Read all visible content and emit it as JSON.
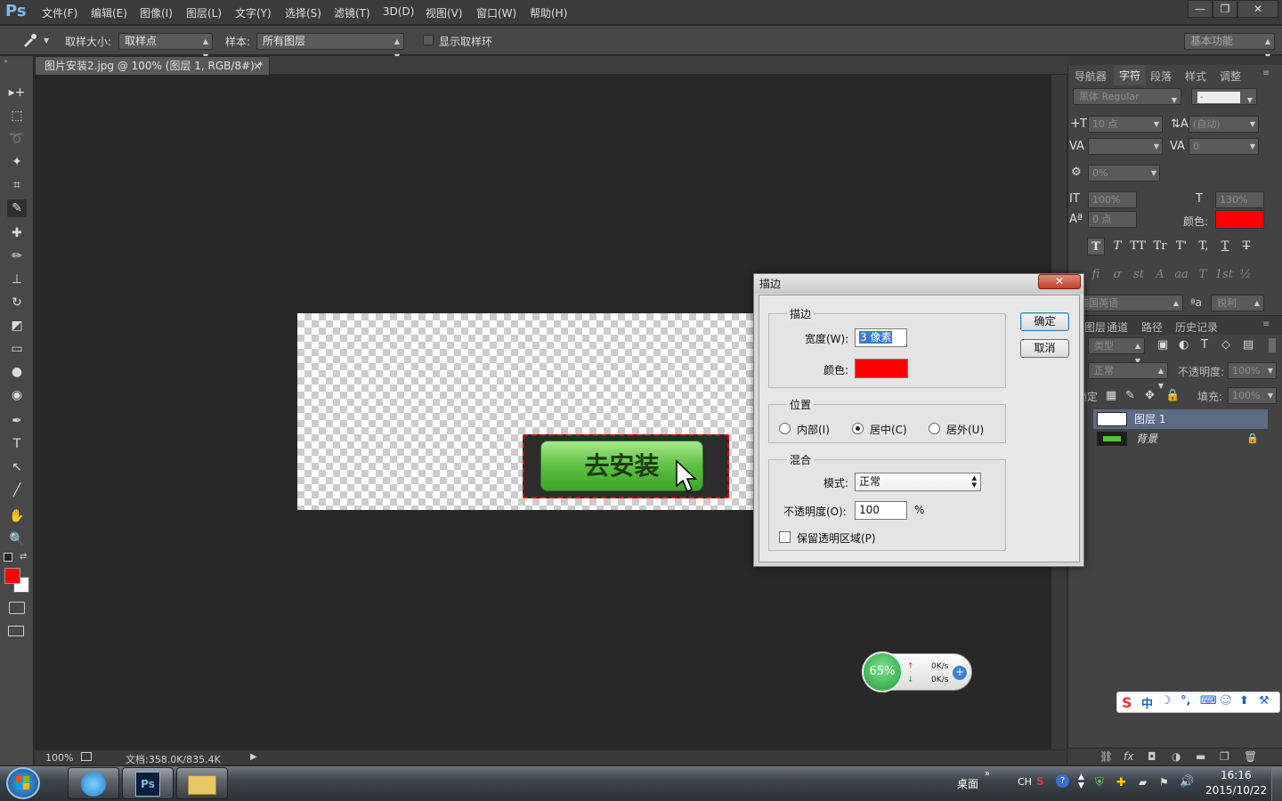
{
  "app": {
    "logo": "Ps",
    "menus": [
      "文件(F)",
      "编辑(E)",
      "图像(I)",
      "图层(L)",
      "文字(Y)",
      "选择(S)",
      "滤镜(T)",
      "3D(D)",
      "视图(V)",
      "窗口(W)",
      "帮助(H)"
    ],
    "window_buttons": [
      "—",
      "❐",
      "✕"
    ]
  },
  "options": {
    "sample_size_label": "取样大小:",
    "sample_size_value": "取样点",
    "sample_label": "样本:",
    "sample_value": "所有图层",
    "show_ring_label": "显示取样环",
    "workspace": "基本功能"
  },
  "document": {
    "tab_title": "图片安装2.jpg @ 100% (图层 1, RGB/8#) *",
    "tab_close": "×",
    "button_text": "去安装",
    "zoom": "100%",
    "doc_info": "文档:358.0K/835.4K"
  },
  "tools": [
    "move-icon",
    "marquee-icon",
    "lasso-icon",
    "magic-wand-icon",
    "crop-icon",
    "eyedropper-icon",
    "spot-heal-icon",
    "brush-icon",
    "stamp-icon",
    "history-brush-icon",
    "eraser-icon",
    "gradient-icon",
    "blur-icon",
    "dodge-icon",
    "pen-icon",
    "type-icon",
    "path-select-icon",
    "line-icon",
    "hand-icon",
    "zoom-icon"
  ],
  "colors": {
    "foreground": "#ff0000",
    "background": "#ffffff",
    "stroke_color": "#ff0000",
    "char_color": "#ff0000"
  },
  "character_panel": {
    "tabs": [
      "导航器",
      "字符",
      "段落",
      "样式",
      "调整"
    ],
    "active_tab": "字符",
    "font_family": "黑体 Regular",
    "font_style": "-",
    "font_size": "10 点",
    "leading": "(自动)",
    "kerning": "",
    "tracking": "0",
    "scale_pct": "0%",
    "vscale": "100%",
    "hscale": "130%",
    "baseline": "0 点",
    "color_label": "颜色:",
    "style_buttons": [
      "T",
      "T",
      "TT",
      "Tr",
      "T'",
      "T,",
      "T",
      "T"
    ],
    "opentype_buttons": [
      "fi",
      "σ",
      "st",
      "A",
      "aa",
      "T",
      "1st",
      "½"
    ],
    "language": "美国英语",
    "aa_label": "ªa",
    "antialias": "锐利"
  },
  "layers_panel": {
    "tabs": [
      "图层",
      "通道",
      "路径",
      "历史记录"
    ],
    "filter": "类型",
    "blend_mode": "正常",
    "opacity_label": "不透明度:",
    "opacity": "100%",
    "lock_label": "锁定:",
    "fill_label": "填充:",
    "fill": "100%",
    "layers": [
      {
        "name": "图层 1",
        "selected": true
      },
      {
        "name": "背景",
        "selected": false
      }
    ],
    "footer_icons": [
      "link-icon",
      "fx-icon",
      "mask-icon",
      "adjustment-icon",
      "folder-icon",
      "new-layer-icon",
      "trash-icon"
    ]
  },
  "dialog": {
    "title": "描边",
    "close": "✕",
    "stroke_group": "描边",
    "width_label": "宽度(W):",
    "width_value": "3 像素",
    "color_label": "颜色:",
    "position_group": "位置",
    "positions": [
      "内部(I)",
      "居中(C)",
      "居外(U)"
    ],
    "selected_position": "居中(C)",
    "blend_group": "混合",
    "mode_label": "模式:",
    "mode_value": "正常",
    "opacity_label": "不透明度(O):",
    "opacity_value": "100",
    "percent": "%",
    "preserve_label": "保留透明区域(P)",
    "ok": "确定",
    "cancel": "取消"
  },
  "widget": {
    "percent": "65%",
    "up": "0K/s",
    "down": "0K/s"
  },
  "ime": {
    "items": [
      "S",
      "中",
      "☽",
      "°,",
      "⌨",
      "☺",
      "⬆",
      "⚒"
    ]
  },
  "taskbar": {
    "desktop": "桌面",
    "lang": "CH",
    "time": "16:16",
    "date": "2015/10/22",
    "ps_label": "Ps"
  }
}
